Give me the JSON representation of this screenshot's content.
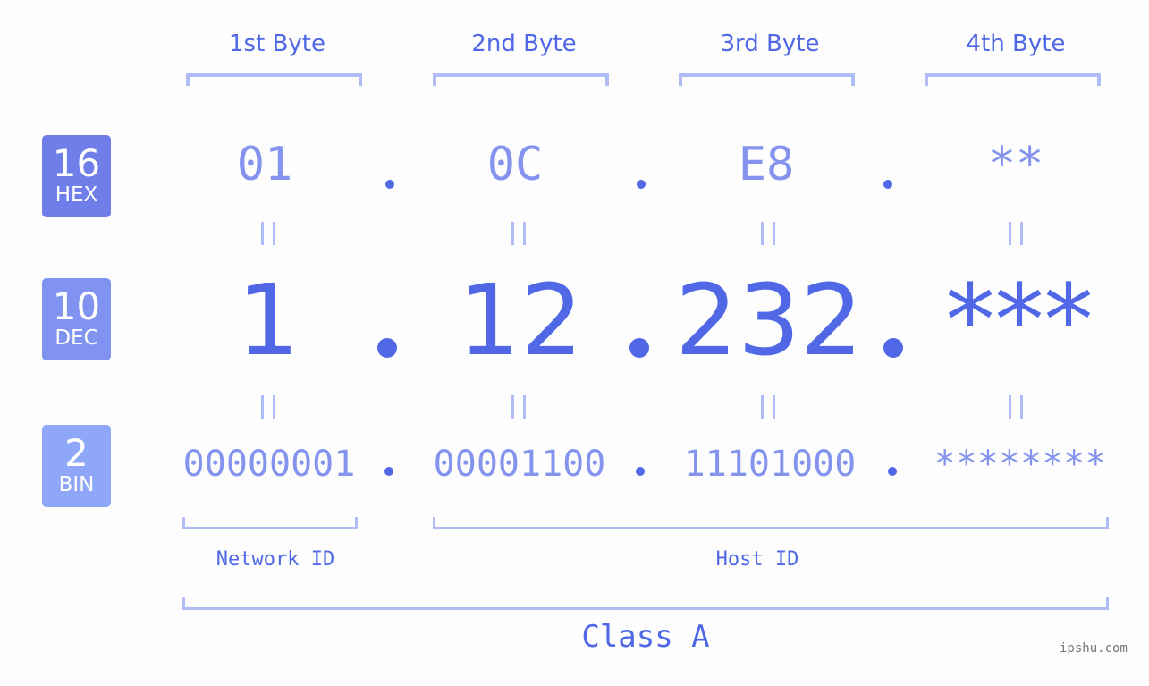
{
  "byte_headers": [
    "1st Byte",
    "2nd Byte",
    "3rd Byte",
    "4th Byte"
  ],
  "badges": {
    "hex": {
      "number": "16",
      "label": "HEX",
      "color": "#6f7ee8"
    },
    "dec": {
      "number": "10",
      "label": "DEC",
      "color": "#8193f0"
    },
    "bin": {
      "number": "2",
      "label": "BIN",
      "color": "#8fa7f8"
    }
  },
  "hex_values": [
    "01",
    "0C",
    "E8",
    "**"
  ],
  "dec_values": [
    "1",
    "12",
    "232",
    "***"
  ],
  "bin_values": [
    "00000001",
    "00001100",
    "11101000",
    "********"
  ],
  "segments": {
    "network_label": "Network ID",
    "host_label": "Host ID"
  },
  "class_label": "Class A",
  "watermark": "ipshu.com",
  "colors": {
    "accent": "#5068e6",
    "light_value": "#8493ee",
    "bracket": "#b0bcf6",
    "background": "#fcfdfc"
  }
}
